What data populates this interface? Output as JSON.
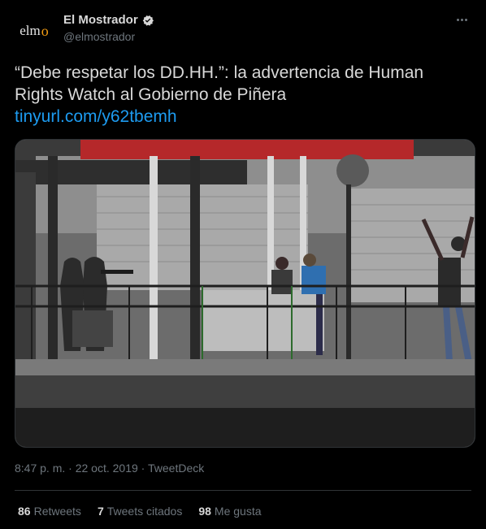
{
  "author": {
    "avatar_text": "elm",
    "avatar_dot": "o",
    "display_name": "El Mostrador",
    "handle": "@elmostrador",
    "verified": true
  },
  "tweet": {
    "text": "“Debe respetar los DD.HH.”: la advertencia de Human Rights Watch al Gobierno de Piñera",
    "link": "tinyurl.com/y62tbemh",
    "time": "8:47 p. m.",
    "date": "22 oct. 2019",
    "source": "TweetDeck",
    "separator": "·"
  },
  "stats": {
    "retweets_count": "86",
    "retweets_label": "Retweets",
    "quotes_count": "7",
    "quotes_label": "Tweets citados",
    "likes_count": "98",
    "likes_label": "Me gusta"
  },
  "colors": {
    "background": "#000000",
    "text": "#d9d9d9",
    "muted": "#6e767d",
    "link": "#1d9bf0",
    "brand_dot": "#f39c12"
  }
}
